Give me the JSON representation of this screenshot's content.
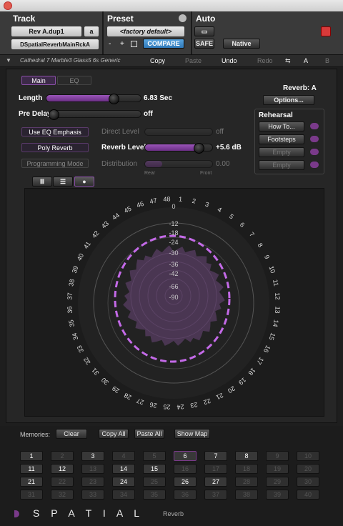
{
  "header": {
    "track_label": "Track",
    "preset_label": "Preset",
    "auto_label": "Auto",
    "track_name": "Rev A.dup1",
    "track_channel": "a",
    "plugin_name": "DSpatialReverbMainRckA",
    "preset_name": "<factory default>",
    "minus": "-",
    "plus": "+",
    "compare": "COMPARE",
    "safe": "SAFE",
    "native": "Native"
  },
  "strip": {
    "preset_path": "Cathedral 7 Marble3 Glass5 6s Generic",
    "copy": "Copy",
    "paste": "Paste",
    "undo": "Undo",
    "redo": "Redo",
    "a": "A",
    "b": "B"
  },
  "tabs": {
    "main": "Main",
    "eq": "EQ"
  },
  "reverb_label": "Reverb: A",
  "options": "Options...",
  "params": {
    "length_label": "Length",
    "length_value": "6.83 Sec",
    "length_fraction": 0.7,
    "predelay_label": "Pre Delay",
    "predelay_value": "off",
    "direct_label": "Direct Level",
    "direct_value": "off",
    "reverb_level_label": "Reverb Level",
    "reverb_level_value": "+5.6 dB",
    "reverb_level_fraction": 0.78,
    "distribution_label": "Distribution",
    "distribution_value": "0.00",
    "rear": "Rear",
    "front": "Front"
  },
  "buttons": {
    "eq_emphasis": "Use EQ Emphasis",
    "poly_reverb": "Poly Reverb",
    "programming_mode": "Programming Mode"
  },
  "rehearsal": {
    "title": "Rehearsal",
    "items": [
      "How To...",
      "Footsteps",
      "Empty",
      "Empty"
    ]
  },
  "view_buttons": [
    "bars-view-icon",
    "list-view-icon",
    "circle-view-icon"
  ],
  "radar": {
    "db_labels": [
      "0",
      "-12",
      "-18",
      "-24",
      "-30",
      "-36",
      "-42",
      "-66",
      "-90"
    ],
    "channels": [
      "1",
      "2",
      "3",
      "4",
      "5",
      "6",
      "7",
      "8",
      "9",
      "10",
      "11",
      "12",
      "13",
      "14",
      "15",
      "16",
      "17",
      "18",
      "19",
      "20",
      "21",
      "22",
      "23",
      "24",
      "25",
      "26",
      "27",
      "28",
      "29",
      "30",
      "31",
      "32",
      "33",
      "34",
      "35",
      "36",
      "37",
      "38",
      "39",
      "40",
      "41",
      "42",
      "43",
      "44",
      "45",
      "46",
      "47",
      "48"
    ]
  },
  "memories": {
    "label": "Memories:",
    "clear": "Clear",
    "copy_all": "Copy All",
    "paste_all": "Paste All",
    "show_map": "Show Map",
    "slots": [
      "1",
      "2",
      "3",
      "4",
      "5",
      "6",
      "7",
      "8",
      "9",
      "10",
      "11",
      "12",
      "13",
      "14",
      "15",
      "16",
      "17",
      "18",
      "19",
      "20",
      "21",
      "22",
      "23",
      "24",
      "25",
      "26",
      "27",
      "28",
      "29",
      "30",
      "31",
      "32",
      "33",
      "34",
      "35",
      "36",
      "37",
      "38",
      "39",
      "40"
    ],
    "active": [
      1,
      3,
      6,
      7,
      8,
      11,
      12,
      14,
      15,
      21,
      24,
      26,
      27
    ],
    "selected": 6
  },
  "brand": {
    "name": "S P A T I A L",
    "sub": "Reverb"
  },
  "colors": {
    "accent": "#9b4fc0",
    "compare": "#3b8ad0",
    "close": "#d83a3a"
  }
}
